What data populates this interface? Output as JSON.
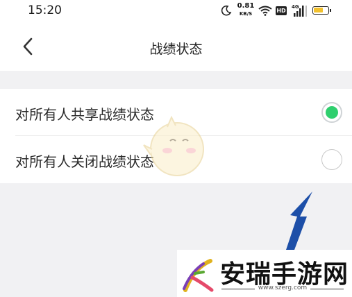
{
  "status_bar": {
    "time": "15:20",
    "net_speed_value": "0.81",
    "net_speed_unit": "KB/S",
    "hd_badge": "HD",
    "signal_label": "4G",
    "icons": [
      "moon-icon",
      "wifi-icon",
      "hd-icon",
      "signal-icon",
      "battery-icon"
    ]
  },
  "header": {
    "title": "战绩状态",
    "back_icon": "chevron-left-icon"
  },
  "options": [
    {
      "label": "对所有人共享战绩状态",
      "selected": true
    },
    {
      "label": "对所有人关闭战绩状态",
      "selected": false
    }
  ],
  "colors": {
    "radio_selected": "#2fcf6e",
    "arrow": "#1d4fa8",
    "background": "#f1f1f3"
  },
  "watermark": {
    "name": "安瑞手游网",
    "url": "www.szerg.com"
  }
}
